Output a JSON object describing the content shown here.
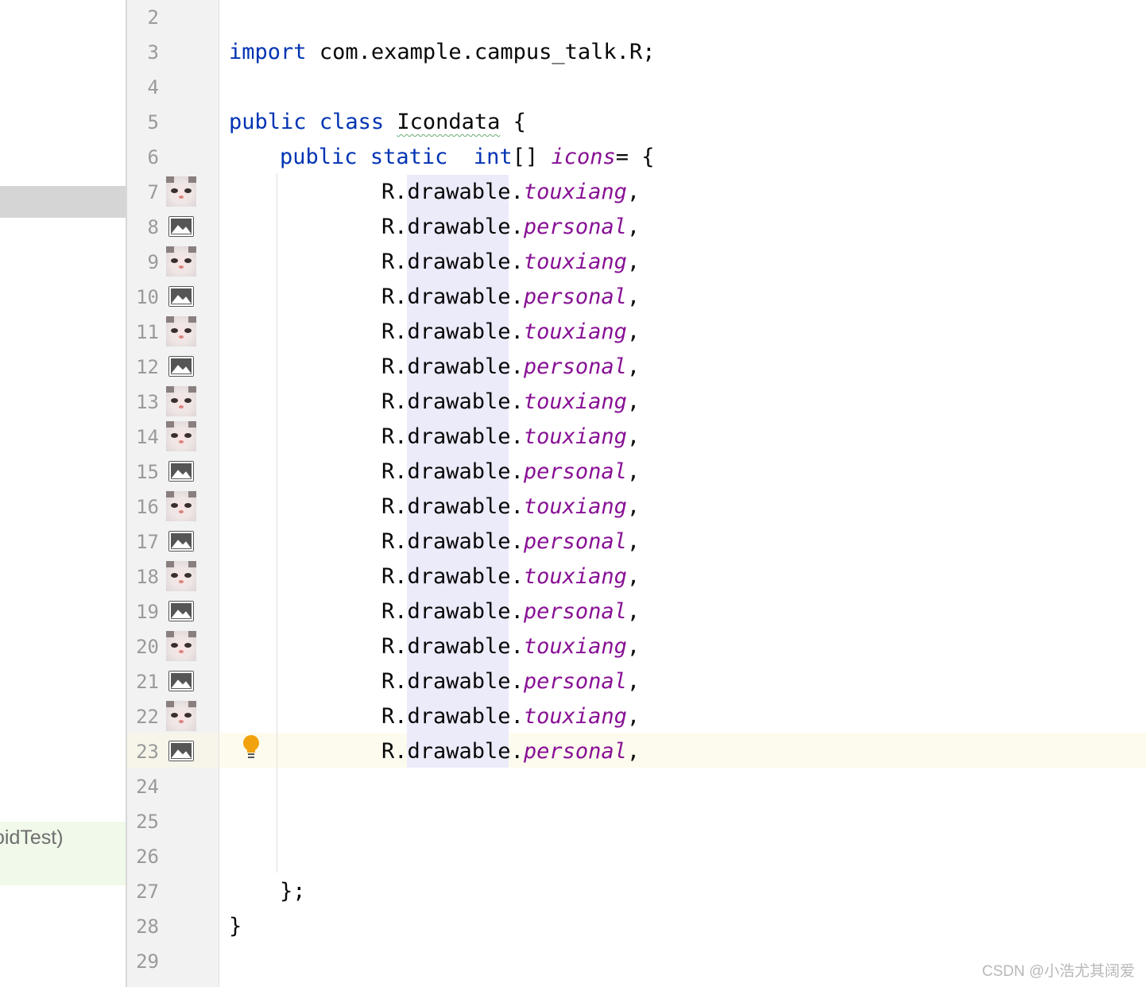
{
  "project_panel": {
    "test_label": "oidTest)"
  },
  "gutter": {
    "line_numbers": [
      "2",
      "3",
      "4",
      "5",
      "6",
      "7",
      "8",
      "9",
      "10",
      "11",
      "12",
      "13",
      "14",
      "15",
      "16",
      "17",
      "18",
      "19",
      "20",
      "21",
      "22",
      "23",
      "24",
      "25",
      "26",
      "27",
      "28",
      "29"
    ],
    "icon_names": [
      "cat-photo-icon",
      "image-icon",
      "cat-photo-icon",
      "image-icon",
      "cat-photo-icon",
      "image-icon",
      "cat-photo-icon",
      "cat-photo-icon",
      "image-icon",
      "cat-photo-icon",
      "image-icon",
      "cat-photo-icon",
      "image-icon",
      "cat-photo-icon",
      "image-icon",
      "cat-photo-icon",
      "image-icon"
    ]
  },
  "code": {
    "import_kw": "import",
    "import_path": "com.example.campus_talk.R;",
    "public_kw": "public",
    "class_kw": "class",
    "class_name": "Icondata",
    "open_brace": " {",
    "public_kw2": "public",
    "static_kw": "static",
    "int_kw": "int",
    "array_brackets": "[]",
    "field_name": "icons",
    "assign": "= {",
    "prefix_R": "R.",
    "drawable": "drawable",
    "dot": ".",
    "comma": ",",
    "entries": [
      "touxiang",
      "personal",
      "touxiang",
      "personal",
      "touxiang",
      "personal",
      "touxiang",
      "touxiang",
      "personal",
      "touxiang",
      "personal",
      "touxiang",
      "personal",
      "touxiang",
      "personal",
      "touxiang",
      "personal"
    ],
    "close_array": "};",
    "close_class": "}"
  },
  "colors": {
    "keyword": "#0033b3",
    "field": "#871094",
    "text": "#080808",
    "current_line": "#fdfbee",
    "highlight": "#ecebfa"
  },
  "watermark": "CSDN @小浩尤其阔爱"
}
